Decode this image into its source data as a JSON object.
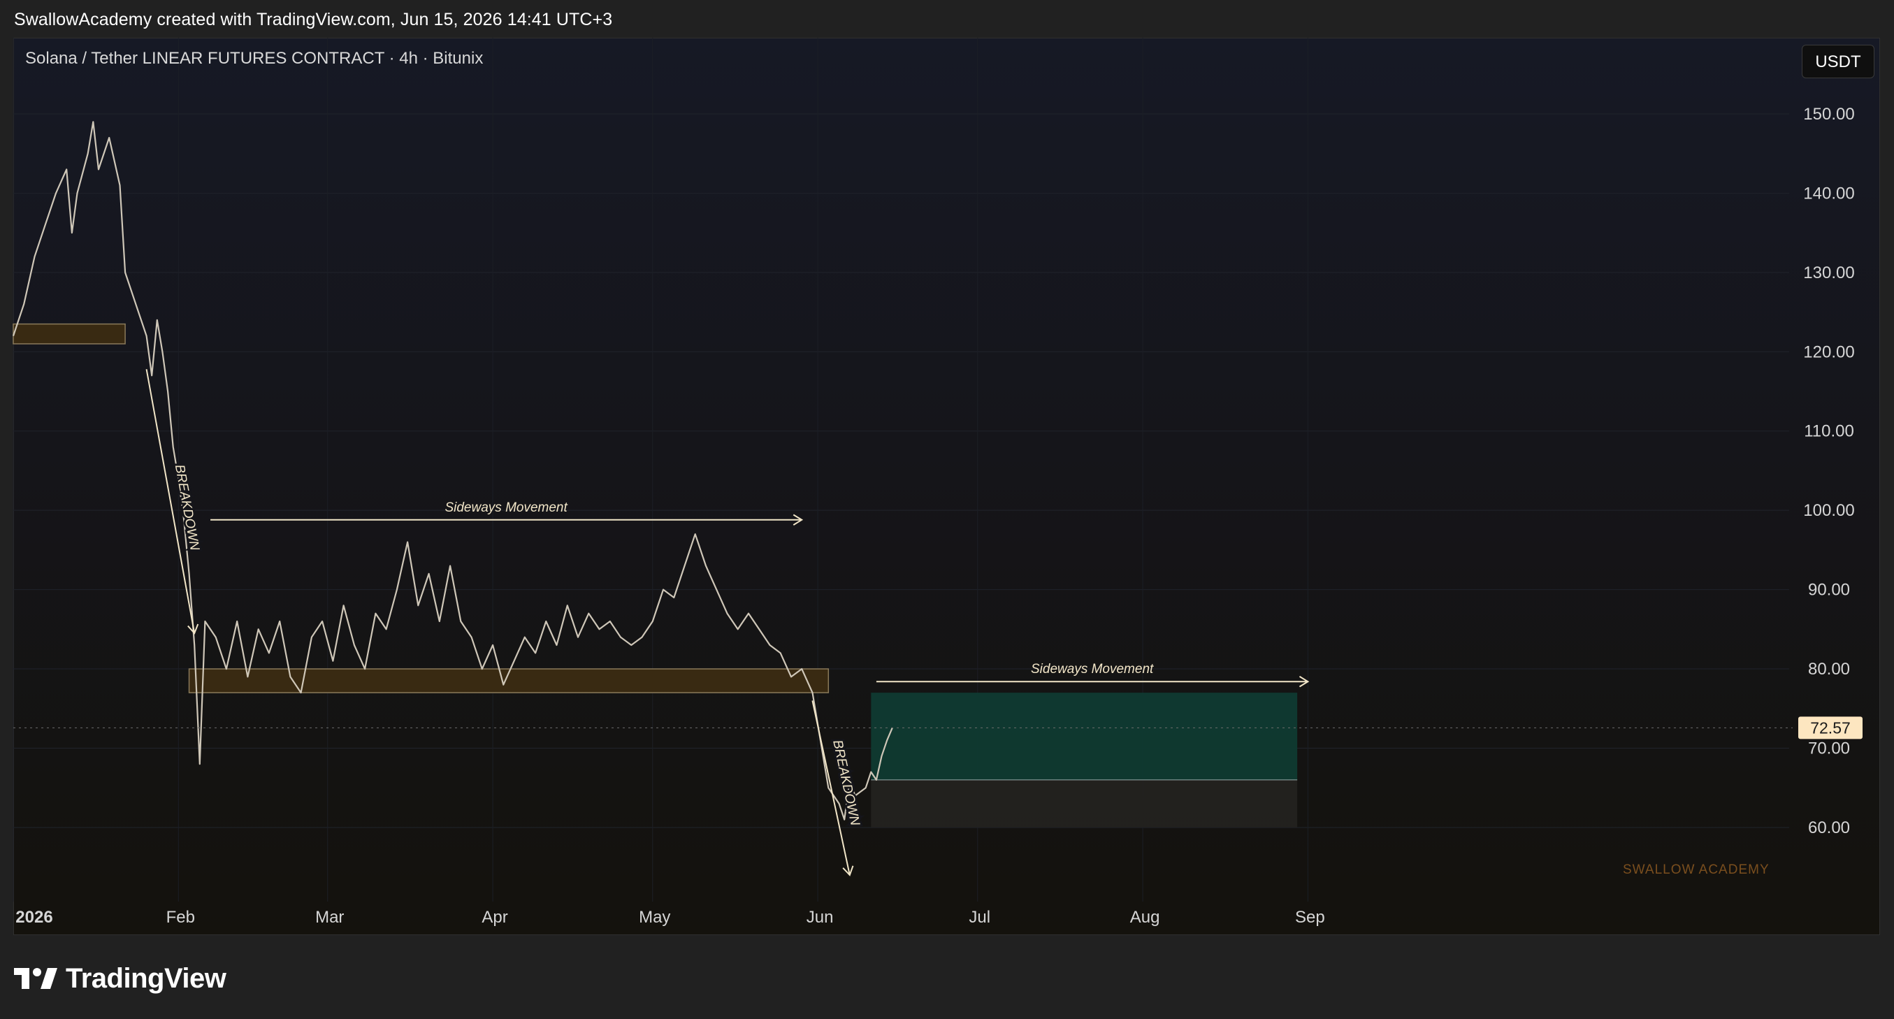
{
  "header": {
    "credit": "SwallowAcademy created with TradingView.com, Jun 15, 2026 14:41 UTC+3"
  },
  "chart": {
    "symbol_title": "Solana / Tether LINEAR FUTURES CONTRACT · 4h · Bitunix",
    "currency_button": "USDT",
    "watermark": "SWALLOW ACADEMY"
  },
  "footer": {
    "brand": "TradingView"
  },
  "colors": {
    "price_line": "#cfc7b8",
    "zone_fill": "#3d2c12",
    "zone_border": "#8a7a5a",
    "green_zone": "#0f3a32",
    "grey_zone": "#232220",
    "annotation": "#f2e6c8",
    "last_price_badge": "#fde6c0"
  },
  "chart_data": {
    "type": "line",
    "title": "Solana / Tether LINEAR FUTURES CONTRACT · 4h · Bitunix",
    "y_ticks": [
      "150.00",
      "140.00",
      "130.00",
      "120.00",
      "110.00",
      "100.00",
      "90.00",
      "80.00",
      "70.00",
      "60.00"
    ],
    "x_ticks": [
      "2026",
      "Feb",
      "Mar",
      "Apr",
      "May",
      "Jun",
      "Jul",
      "Aug",
      "Sep"
    ],
    "ylim": [
      50.5,
      159
    ],
    "last_price": "72.57",
    "series": [
      {
        "values": [
          [
            "2026-01-01",
            122
          ],
          [
            "2026-01-03",
            126
          ],
          [
            "2026-01-05",
            132
          ],
          [
            "2026-01-07",
            136
          ],
          [
            "2026-01-09",
            140
          ],
          [
            "2026-01-11",
            143
          ],
          [
            "2026-01-12",
            135
          ],
          [
            "2026-01-13",
            140
          ],
          [
            "2026-01-15",
            145
          ],
          [
            "2026-01-16",
            149
          ],
          [
            "2026-01-17",
            143
          ],
          [
            "2026-01-19",
            147
          ],
          [
            "2026-01-21",
            141
          ],
          [
            "2026-01-22",
            130
          ],
          [
            "2026-01-24",
            126
          ],
          [
            "2026-01-26",
            122
          ],
          [
            "2026-01-27",
            117
          ],
          [
            "2026-01-28",
            124
          ],
          [
            "2026-01-29",
            120
          ],
          [
            "2026-01-30",
            115
          ],
          [
            "2026-01-31",
            108
          ],
          [
            "2026-02-01",
            104
          ],
          [
            "2026-02-02",
            99
          ],
          [
            "2026-02-03",
            92
          ],
          [
            "2026-02-04",
            83
          ],
          [
            "2026-02-05",
            68
          ],
          [
            "2026-02-06",
            86
          ],
          [
            "2026-02-08",
            84
          ],
          [
            "2026-02-10",
            80
          ],
          [
            "2026-02-12",
            86
          ],
          [
            "2026-02-14",
            79
          ],
          [
            "2026-02-16",
            85
          ],
          [
            "2026-02-18",
            82
          ],
          [
            "2026-02-20",
            86
          ],
          [
            "2026-02-22",
            79
          ],
          [
            "2026-02-24",
            77
          ],
          [
            "2026-02-26",
            84
          ],
          [
            "2026-02-28",
            86
          ],
          [
            "2026-03-02",
            81
          ],
          [
            "2026-03-04",
            88
          ],
          [
            "2026-03-06",
            83
          ],
          [
            "2026-03-08",
            80
          ],
          [
            "2026-03-10",
            87
          ],
          [
            "2026-03-12",
            85
          ],
          [
            "2026-03-14",
            90
          ],
          [
            "2026-03-16",
            96
          ],
          [
            "2026-03-18",
            88
          ],
          [
            "2026-03-20",
            92
          ],
          [
            "2026-03-22",
            86
          ],
          [
            "2026-03-24",
            93
          ],
          [
            "2026-03-26",
            86
          ],
          [
            "2026-03-28",
            84
          ],
          [
            "2026-03-30",
            80
          ],
          [
            "2026-04-01",
            83
          ],
          [
            "2026-04-03",
            78
          ],
          [
            "2026-04-05",
            81
          ],
          [
            "2026-04-07",
            84
          ],
          [
            "2026-04-09",
            82
          ],
          [
            "2026-04-11",
            86
          ],
          [
            "2026-04-13",
            83
          ],
          [
            "2026-04-15",
            88
          ],
          [
            "2026-04-17",
            84
          ],
          [
            "2026-04-19",
            87
          ],
          [
            "2026-04-21",
            85
          ],
          [
            "2026-04-23",
            86
          ],
          [
            "2026-04-25",
            84
          ],
          [
            "2026-04-27",
            83
          ],
          [
            "2026-04-29",
            84
          ],
          [
            "2026-05-01",
            86
          ],
          [
            "2026-05-03",
            90
          ],
          [
            "2026-05-05",
            89
          ],
          [
            "2026-05-07",
            93
          ],
          [
            "2026-05-09",
            97
          ],
          [
            "2026-05-11",
            93
          ],
          [
            "2026-05-13",
            90
          ],
          [
            "2026-05-15",
            87
          ],
          [
            "2026-05-17",
            85
          ],
          [
            "2026-05-19",
            87
          ],
          [
            "2026-05-21",
            85
          ],
          [
            "2026-05-23",
            83
          ],
          [
            "2026-05-25",
            82
          ],
          [
            "2026-05-27",
            79
          ],
          [
            "2026-05-29",
            80
          ],
          [
            "2026-05-31",
            77
          ],
          [
            "2026-06-01",
            73
          ],
          [
            "2026-06-03",
            65
          ],
          [
            "2026-06-05",
            63
          ],
          [
            "2026-06-06",
            61
          ],
          [
            "2026-06-07",
            66
          ],
          [
            "2026-06-08",
            64
          ],
          [
            "2026-06-10",
            65
          ],
          [
            "2026-06-11",
            67
          ],
          [
            "2026-06-12",
            66
          ],
          [
            "2026-06-13",
            69
          ],
          [
            "2026-06-14",
            71
          ],
          [
            "2026-06-15",
            72.57
          ]
        ]
      }
    ],
    "annotations": {
      "sideways_1": "Sideways Movement",
      "sideways_2": "Sideways Movement",
      "breakdown_1": "BREAKDOWN",
      "breakdown_2": "BREAKDOWN"
    },
    "zones": {
      "zone_1": {
        "from": "2026-01-01",
        "to": "2026-01-22",
        "low": 121,
        "high": 123.5
      },
      "zone_2": {
        "from": "2026-02-03",
        "to": "2026-06-03",
        "low": 77,
        "high": 80
      },
      "green": {
        "from": "2026-06-11",
        "to": "2026-08-30",
        "low": 66,
        "high": 77
      },
      "grey": {
        "from": "2026-06-11",
        "to": "2026-08-30",
        "low": 60,
        "high": 66
      }
    }
  }
}
